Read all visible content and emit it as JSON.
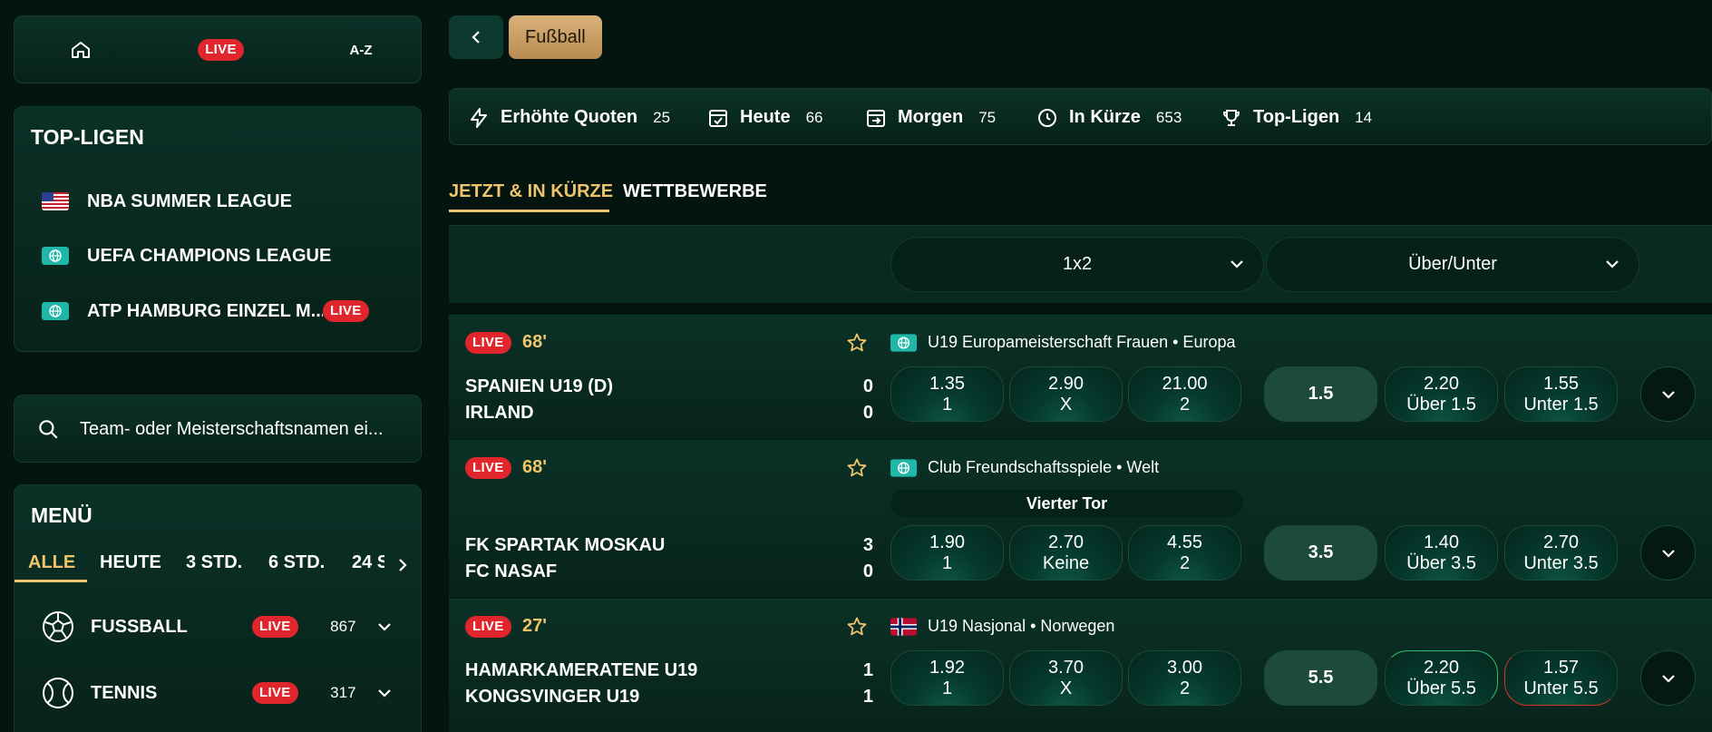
{
  "nav": {
    "home_icon": "home-icon",
    "live": "LIVE",
    "az": "A-Z"
  },
  "top_leagues": {
    "title": "TOP-LIGEN",
    "items": [
      {
        "name": "NBA SUMMER LEAGUE",
        "flag": "us-flag-icon",
        "live": ""
      },
      {
        "name": "UEFA CHAMPIONS LEAGUE",
        "flag": "globe-icon",
        "live": ""
      },
      {
        "name": "ATP HAMBURG EINZEL M...",
        "flag": "globe-icon",
        "live": "LIVE"
      }
    ]
  },
  "search": {
    "placeholder": "Team- oder Meisterschaftsnamen ei..."
  },
  "menu": {
    "title": "MENÜ",
    "filters": [
      "ALLE",
      "HEUTE",
      "3 STD.",
      "6 STD.",
      "24 S"
    ],
    "active_filter": "ALLE",
    "sports": [
      {
        "name": "FUSSBALL",
        "live": "LIVE",
        "count": "867"
      },
      {
        "name": "TENNIS",
        "live": "LIVE",
        "count": "317"
      }
    ]
  },
  "header": {
    "sport": "Fußball",
    "quick": [
      {
        "label": "Erhöhte Quoten",
        "count": "25",
        "icon": "lightning-icon"
      },
      {
        "label": "Heute",
        "count": "66",
        "icon": "calendar-check-icon"
      },
      {
        "label": "Morgen",
        "count": "75",
        "icon": "calendar-arrow-icon"
      },
      {
        "label": "In Kürze",
        "count": "653",
        "icon": "clock-icon"
      },
      {
        "label": "Top-Ligen",
        "count": "14",
        "icon": "trophy-icon"
      }
    ],
    "tabs": [
      "JETZT & IN KÜRZE",
      "WETTBEWERBE"
    ],
    "active_tab": "JETZT & IN KÜRZE"
  },
  "markets": {
    "primary": "1x2",
    "secondary": "Über/Unter"
  },
  "matches": [
    {
      "live": "LIVE",
      "minute": "68'",
      "competition": "U19 Europameisterschaft Frauen • Europa",
      "comp_flag": "globe-icon",
      "home": "SPANIEN U19 (D)",
      "away": "IRLAND",
      "home_score": "0",
      "away_score": "0",
      "sub_market": "",
      "odds": [
        {
          "value": "1.35",
          "label": "1"
        },
        {
          "value": "2.90",
          "label": "X"
        },
        {
          "value": "21.00",
          "label": "2"
        }
      ],
      "line": "1.5",
      "ou": [
        {
          "value": "2.20",
          "label": "Über 1.5"
        },
        {
          "value": "1.55",
          "label": "Unter 1.5"
        }
      ]
    },
    {
      "live": "LIVE",
      "minute": "68'",
      "competition": "Club Freundschaftsspiele • Welt",
      "comp_flag": "globe-icon",
      "home": "FK SPARTAK MOSKAU",
      "away": "FC NASAF",
      "home_score": "3",
      "away_score": "0",
      "sub_market": "Vierter Tor",
      "odds": [
        {
          "value": "1.90",
          "label": "1"
        },
        {
          "value": "2.70",
          "label": "Keine"
        },
        {
          "value": "4.55",
          "label": "2"
        }
      ],
      "line": "3.5",
      "ou": [
        {
          "value": "1.40",
          "label": "Über 3.5"
        },
        {
          "value": "2.70",
          "label": "Unter 3.5"
        }
      ]
    },
    {
      "live": "LIVE",
      "minute": "27'",
      "competition": "U19 Nasjonal • Norwegen",
      "comp_flag": "norway-flag-icon",
      "home": "HAMARKAMERATENE U19",
      "away": "KONGSVINGER U19",
      "home_score": "1",
      "away_score": "1",
      "sub_market": "",
      "odds": [
        {
          "value": "1.92",
          "label": "1"
        },
        {
          "value": "3.70",
          "label": "X"
        },
        {
          "value": "3.00",
          "label": "2"
        }
      ],
      "line": "5.5",
      "ou": [
        {
          "value": "2.20",
          "label": "Über 5.5"
        },
        {
          "value": "1.57",
          "label": "Unter 5.5"
        }
      ]
    }
  ],
  "colors": {
    "accent": "#f0c46a",
    "live": "#e0262c",
    "background": "#04150f"
  }
}
